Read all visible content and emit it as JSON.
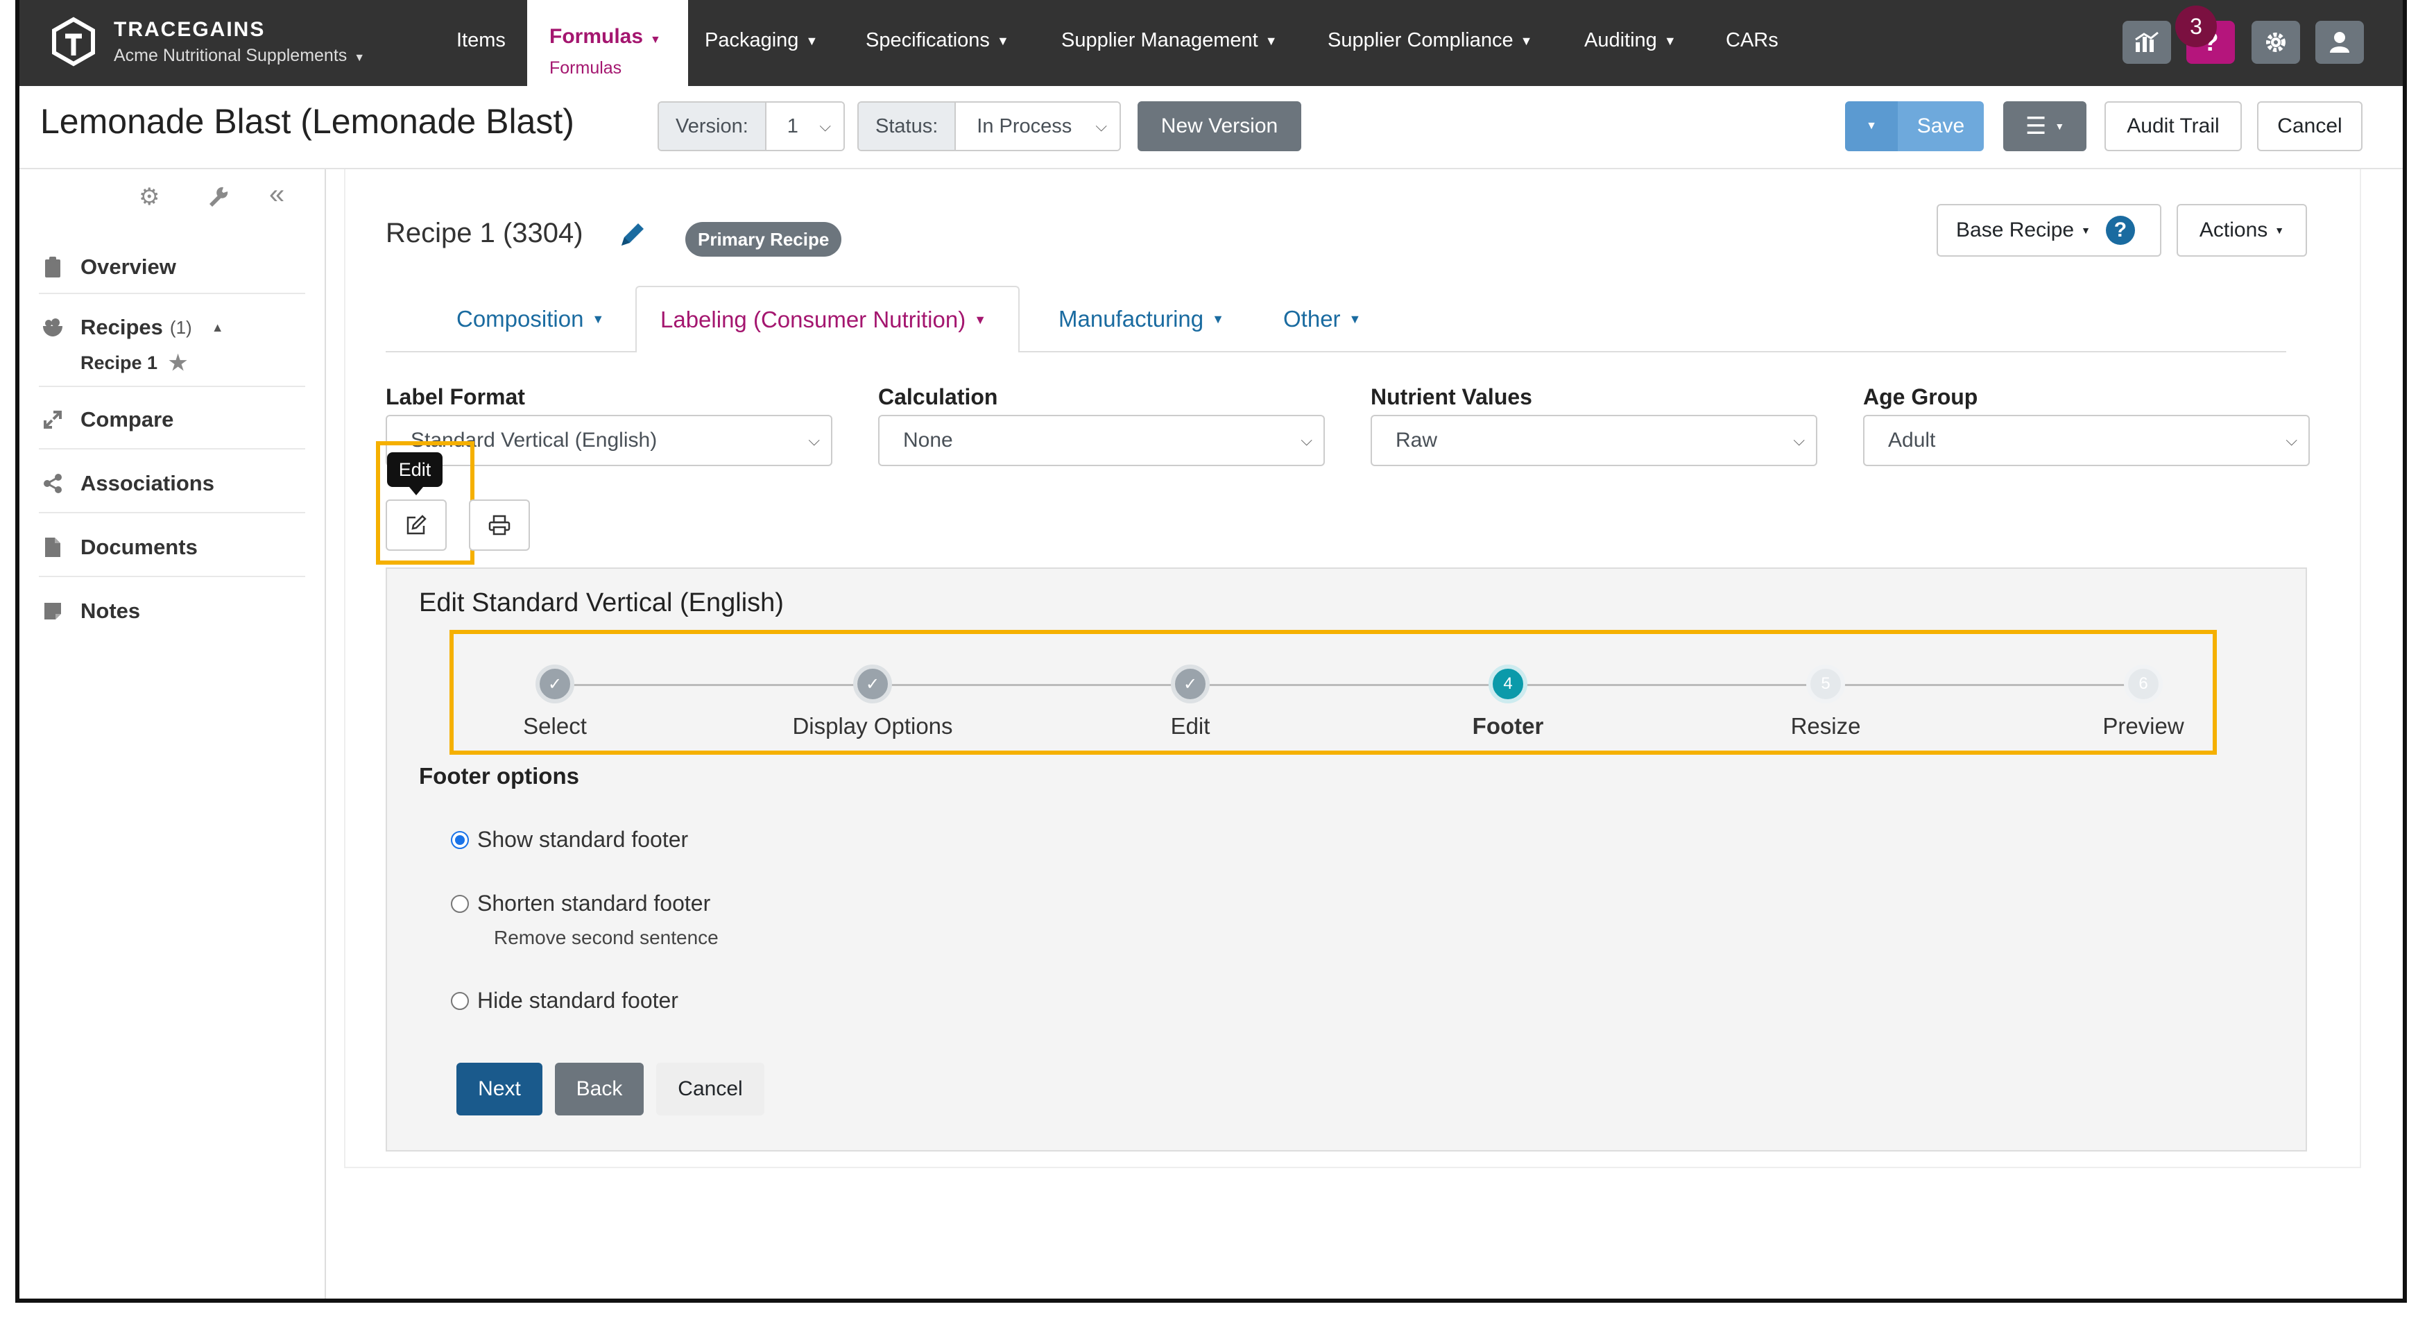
{
  "brand": {
    "name": "TRACEGAINS",
    "company": "Acme Nutritional Supplements"
  },
  "nav": {
    "items": "Items",
    "formulas": "Formulas",
    "formulas_sub": "Formulas",
    "packaging": "Packaging",
    "specifications": "Specifications",
    "supplier_management": "Supplier Management",
    "supplier_compliance": "Supplier Compliance",
    "auditing": "Auditing",
    "cars": "CARs",
    "help_badge": "3",
    "help_label": "?"
  },
  "header": {
    "title": "Lemonade Blast (Lemonade Blast)",
    "version_label": "Version:",
    "version_value": "1",
    "status_label": "Status:",
    "status_value": "In Process",
    "new_version": "New Version",
    "save": "Save",
    "audit_trail": "Audit Trail",
    "cancel": "Cancel"
  },
  "sidebar": {
    "overview": "Overview",
    "recipes": "Recipes",
    "recipes_count": "(1)",
    "recipe_1": "Recipe 1",
    "compare": "Compare",
    "associations": "Associations",
    "documents": "Documents",
    "notes": "Notes"
  },
  "recipe": {
    "title": "Recipe 1 (3304)",
    "badge": "Primary Recipe",
    "base_recipe": "Base Recipe",
    "actions": "Actions",
    "help_icon_label": "?"
  },
  "tabs": {
    "composition": "Composition",
    "labeling": "Labeling (Consumer Nutrition)",
    "manufacturing": "Manufacturing",
    "other": "Other"
  },
  "fields": {
    "label_format": {
      "label": "Label Format",
      "value": "Standard Vertical (English)"
    },
    "calculation": {
      "label": "Calculation",
      "value": "None"
    },
    "nutrient_values": {
      "label": "Nutrient Values",
      "value": "Raw"
    },
    "age_group": {
      "label": "Age Group",
      "value": "Adult"
    }
  },
  "edit_tooltip": "Edit",
  "wizard": {
    "title": "Edit Standard Vertical (English)",
    "steps": [
      {
        "label": "Select",
        "marker": "✓",
        "state": "done"
      },
      {
        "label": "Display Options",
        "marker": "✓",
        "state": "done"
      },
      {
        "label": "Edit",
        "marker": "✓",
        "state": "done"
      },
      {
        "label": "Footer",
        "marker": "4",
        "state": "active"
      },
      {
        "label": "Resize",
        "marker": "5",
        "state": "todo"
      },
      {
        "label": "Preview",
        "marker": "6",
        "state": "todo"
      }
    ],
    "footer_options_title": "Footer options",
    "options": [
      {
        "label": "Show standard footer",
        "selected": true
      },
      {
        "label": "Shorten standard footer",
        "selected": false
      },
      {
        "label": "Hide standard footer",
        "selected": false
      }
    ],
    "shorten_help": "Remove second sentence",
    "next": "Next",
    "back": "Back",
    "cancel": "Cancel"
  },
  "colors": {
    "nav_bg": "#333333",
    "brand_accent": "#a4166f",
    "active_step": "#0b9aaa",
    "highlight": "#f5b000",
    "primary_button": "#1a5a8c"
  }
}
